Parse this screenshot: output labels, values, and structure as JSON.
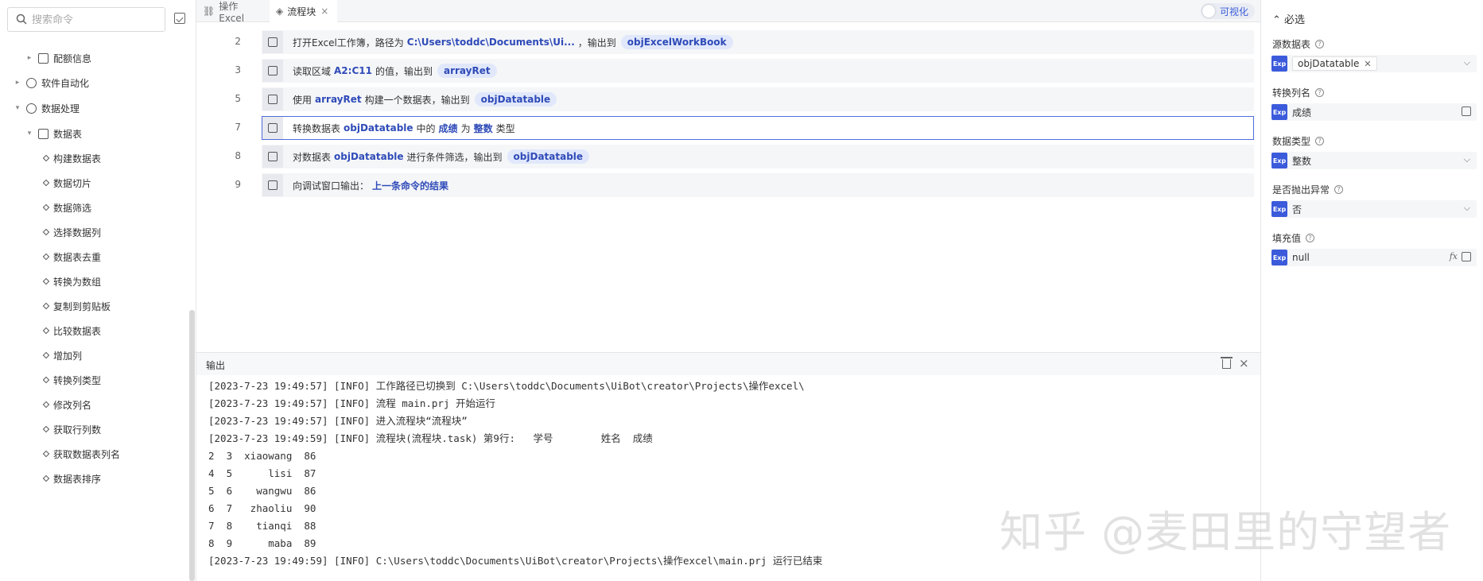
{
  "sidebar": {
    "search_placeholder": "搜索命令",
    "items": [
      {
        "label": "配额信息",
        "caret": "▸"
      },
      {
        "label": "软件自动化",
        "caret": "▸"
      },
      {
        "label": "数据处理",
        "caret": "▾"
      },
      {
        "label": "数据表",
        "caret": "▾"
      },
      {
        "label": "构建数据表"
      },
      {
        "label": "数据切片"
      },
      {
        "label": "数据筛选"
      },
      {
        "label": "选择数据列"
      },
      {
        "label": "数据表去重"
      },
      {
        "label": "转换为数组"
      },
      {
        "label": "复制到剪贴板"
      },
      {
        "label": "比较数据表"
      },
      {
        "label": "增加列"
      },
      {
        "label": "转换列类型"
      },
      {
        "label": "修改列名"
      },
      {
        "label": "获取行列数"
      },
      {
        "label": "获取数据表列名"
      },
      {
        "label": "数据表排序"
      }
    ]
  },
  "tabs": [
    {
      "label": "操作Excel",
      "active": false
    },
    {
      "label": "流程块",
      "active": true,
      "close": "×"
    }
  ],
  "toggle_label": "可视化",
  "steps": [
    {
      "line": "2",
      "parts": [
        {
          "t": "text",
          "v": "打开Excel工作簿，路径为"
        },
        {
          "t": "kw",
          "v": "C:\\Users\\toddc\\Documents\\Ui..."
        },
        {
          "t": "text",
          "v": "，输出到"
        },
        {
          "t": "pill",
          "v": "objExcelWorkBook"
        }
      ]
    },
    {
      "line": "3",
      "parts": [
        {
          "t": "text",
          "v": "读取区域"
        },
        {
          "t": "kw",
          "v": "A2:C11"
        },
        {
          "t": "text",
          "v": "的值，输出到"
        },
        {
          "t": "pill",
          "v": "arrayRet"
        }
      ]
    },
    {
      "line": "5",
      "parts": [
        {
          "t": "text",
          "v": "使用"
        },
        {
          "t": "kw",
          "v": "arrayRet"
        },
        {
          "t": "text",
          "v": "构建一个数据表，输出到"
        },
        {
          "t": "pill",
          "v": "objDatatable"
        }
      ]
    },
    {
      "line": "7",
      "selected": true,
      "parts": [
        {
          "t": "text",
          "v": "转换数据表"
        },
        {
          "t": "kw",
          "v": "objDatatable"
        },
        {
          "t": "text",
          "v": "中的"
        },
        {
          "t": "kw",
          "v": "成绩"
        },
        {
          "t": "text",
          "v": "为"
        },
        {
          "t": "kw",
          "v": "整数"
        },
        {
          "t": "text",
          "v": "类型"
        }
      ]
    },
    {
      "line": "8",
      "parts": [
        {
          "t": "text",
          "v": "对数据表"
        },
        {
          "t": "kw",
          "v": "objDatatable"
        },
        {
          "t": "text",
          "v": "进行条件筛选，输出到"
        },
        {
          "t": "pill",
          "v": "objDatatable"
        }
      ]
    },
    {
      "line": "9",
      "parts": [
        {
          "t": "text",
          "v": "向调试窗口输出："
        },
        {
          "t": "kw",
          "v": "上一条命令的结果"
        }
      ]
    }
  ],
  "output": {
    "title": "输出",
    "lines": [
      "[2023-7-23 19:49:57] [INFO] 工作路径已切换到 C:\\Users\\toddc\\Documents\\UiBot\\creator\\Projects\\操作excel\\",
      "[2023-7-23 19:49:57] [INFO] 流程 main.prj 开始运行",
      "[2023-7-23 19:49:57] [INFO] 进入流程块“流程块”",
      "[2023-7-23 19:49:59] [INFO] 流程块(流程块.task) 第9行:   学号        姓名  成绩",
      "2  3  xiaowang  86",
      "4  5      lisi  87",
      "5  6    wangwu  86",
      "6  7   zhaoliu  90",
      "7  8    tianqi  88",
      "8  9      maba  89",
      "[2023-7-23 19:49:59] [INFO] C:\\Users\\toddc\\Documents\\UiBot\\creator\\Projects\\操作excel\\main.prj 运行已结束"
    ]
  },
  "props": {
    "header": "必选",
    "exp_badge": "Exp",
    "fields": [
      {
        "label": "源数据表",
        "value": "objDatatable",
        "kind": "tag"
      },
      {
        "label": "转换列名",
        "value": "成绩",
        "kind": "edit"
      },
      {
        "label": "数据类型",
        "value": "整数",
        "kind": "select"
      },
      {
        "label": "是否抛出异常",
        "value": "否",
        "kind": "select"
      },
      {
        "label": "填充值",
        "value": "null",
        "kind": "fx",
        "fx": "fx"
      }
    ]
  },
  "watermark": "知乎 @麦田里的守望者",
  "colors": {
    "accent": "#3b5bdb",
    "keyword": "#2f4bb8",
    "pill_bg": "#e1e8fb"
  }
}
